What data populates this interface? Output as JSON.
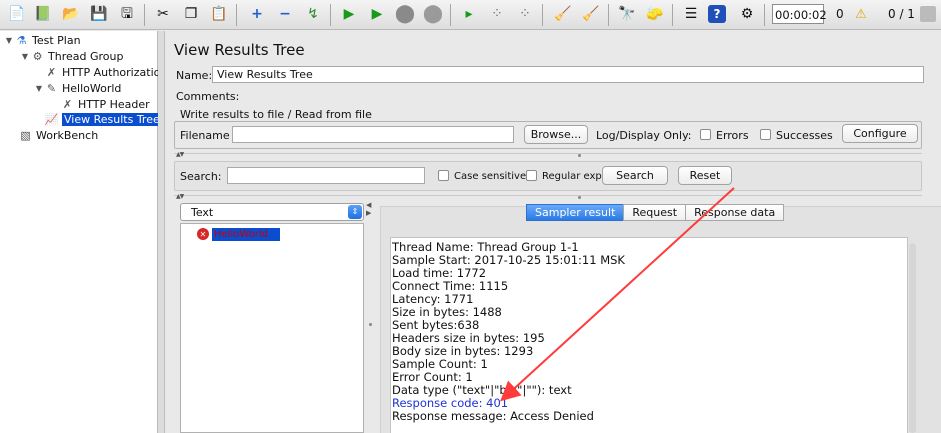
{
  "toolbar": {
    "icons": [
      "new-icon",
      "templates-icon",
      "open-icon",
      "save-icon",
      "save-test-plan-icon",
      "cut-icon",
      "copy-icon",
      "paste-icon",
      "expand-icon",
      "collapse-icon",
      "toggle-icon",
      "start-icon",
      "start-no-pauses-icon",
      "stop-icon",
      "shutdown-icon",
      "remote-start-icon",
      "remote-stop-icon",
      "remote-shutdown-icon",
      "clear-icon",
      "clear-all-icon",
      "search-icon",
      "reset-search-icon",
      "function-helper-icon",
      "help-icon",
      "remote-settings-icon"
    ],
    "timer": "00:00:02",
    "error_count": "0",
    "threads": "0 / 1"
  },
  "tree": {
    "items": [
      {
        "label": "Test Plan"
      },
      {
        "label": "Thread Group"
      },
      {
        "label": "HTTP Authorizatio"
      },
      {
        "label": "HelloWorld"
      },
      {
        "label": "HTTP Header"
      },
      {
        "label": "View Results Tree"
      },
      {
        "label": "WorkBench"
      }
    ]
  },
  "panel": {
    "title": "View Results Tree",
    "name_label": "Name:",
    "name_value": "View Results Tree",
    "comments_label": "Comments:",
    "file_group_title": "Write results to file / Read from file",
    "filename_label": "Filename",
    "filename_value": "",
    "browse_label": "Browse...",
    "log_display_label": "Log/Display Only:",
    "errors_label": "Errors",
    "successes_label": "Successes",
    "configure_label": "Configure",
    "search_label": "Search:",
    "search_value": "",
    "case_sensitive_label": "Case sensitive",
    "regex_label": "Regular exp.",
    "search_button": "Search",
    "reset_button": "Reset"
  },
  "results": {
    "renderer_selected": "Text",
    "sample_item": "HelloWorld",
    "tabs": [
      "Sampler result",
      "Request",
      "Response data"
    ],
    "active_tab": "Sampler result",
    "lines": [
      "Thread Name: Thread Group 1-1",
      "Sample Start: 2017-10-25 15:01:11 MSK",
      "Load time: 1772",
      "Connect Time: 1115",
      "Latency: 1771",
      "Size in bytes: 1488",
      "Sent bytes:638",
      "Headers size in bytes: 195",
      "Body size in bytes: 1293",
      "Sample Count: 1",
      "Error Count: 1",
      "Data type (\"text\"|\"bin\"|\"\"): text",
      "Response code: 401",
      "Response message: Access Denied"
    ]
  },
  "colors": {
    "selection": "#0a4dcf",
    "annotation_arrow": "#ff3b3b",
    "highlight_text": "#1d33d6"
  }
}
